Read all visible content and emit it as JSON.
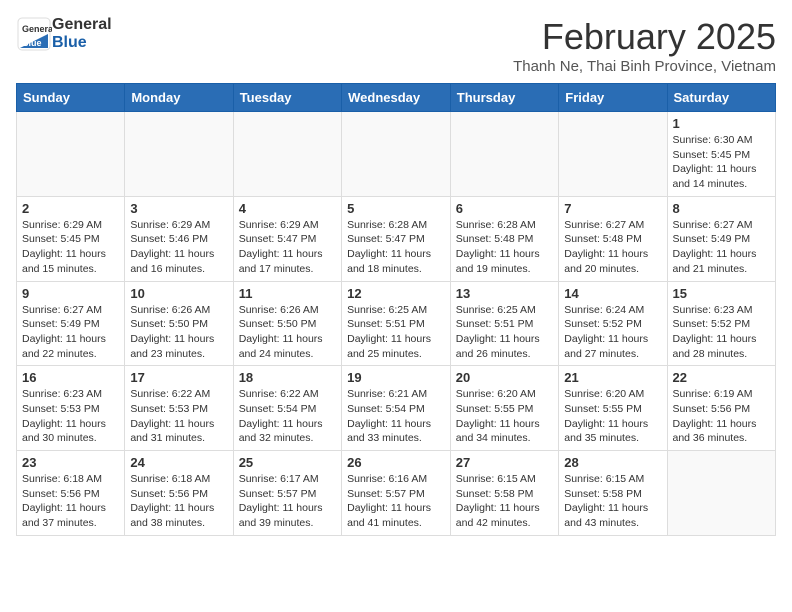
{
  "header": {
    "logo_general": "General",
    "logo_blue": "Blue",
    "month_title": "February 2025",
    "location": "Thanh Ne, Thai Binh Province, Vietnam"
  },
  "weekdays": [
    "Sunday",
    "Monday",
    "Tuesday",
    "Wednesday",
    "Thursday",
    "Friday",
    "Saturday"
  ],
  "weeks": [
    [
      {
        "day": "",
        "info": ""
      },
      {
        "day": "",
        "info": ""
      },
      {
        "day": "",
        "info": ""
      },
      {
        "day": "",
        "info": ""
      },
      {
        "day": "",
        "info": ""
      },
      {
        "day": "",
        "info": ""
      },
      {
        "day": "1",
        "info": "Sunrise: 6:30 AM\nSunset: 5:45 PM\nDaylight: 11 hours\nand 14 minutes."
      }
    ],
    [
      {
        "day": "2",
        "info": "Sunrise: 6:29 AM\nSunset: 5:45 PM\nDaylight: 11 hours\nand 15 minutes."
      },
      {
        "day": "3",
        "info": "Sunrise: 6:29 AM\nSunset: 5:46 PM\nDaylight: 11 hours\nand 16 minutes."
      },
      {
        "day": "4",
        "info": "Sunrise: 6:29 AM\nSunset: 5:47 PM\nDaylight: 11 hours\nand 17 minutes."
      },
      {
        "day": "5",
        "info": "Sunrise: 6:28 AM\nSunset: 5:47 PM\nDaylight: 11 hours\nand 18 minutes."
      },
      {
        "day": "6",
        "info": "Sunrise: 6:28 AM\nSunset: 5:48 PM\nDaylight: 11 hours\nand 19 minutes."
      },
      {
        "day": "7",
        "info": "Sunrise: 6:27 AM\nSunset: 5:48 PM\nDaylight: 11 hours\nand 20 minutes."
      },
      {
        "day": "8",
        "info": "Sunrise: 6:27 AM\nSunset: 5:49 PM\nDaylight: 11 hours\nand 21 minutes."
      }
    ],
    [
      {
        "day": "9",
        "info": "Sunrise: 6:27 AM\nSunset: 5:49 PM\nDaylight: 11 hours\nand 22 minutes."
      },
      {
        "day": "10",
        "info": "Sunrise: 6:26 AM\nSunset: 5:50 PM\nDaylight: 11 hours\nand 23 minutes."
      },
      {
        "day": "11",
        "info": "Sunrise: 6:26 AM\nSunset: 5:50 PM\nDaylight: 11 hours\nand 24 minutes."
      },
      {
        "day": "12",
        "info": "Sunrise: 6:25 AM\nSunset: 5:51 PM\nDaylight: 11 hours\nand 25 minutes."
      },
      {
        "day": "13",
        "info": "Sunrise: 6:25 AM\nSunset: 5:51 PM\nDaylight: 11 hours\nand 26 minutes."
      },
      {
        "day": "14",
        "info": "Sunrise: 6:24 AM\nSunset: 5:52 PM\nDaylight: 11 hours\nand 27 minutes."
      },
      {
        "day": "15",
        "info": "Sunrise: 6:23 AM\nSunset: 5:52 PM\nDaylight: 11 hours\nand 28 minutes."
      }
    ],
    [
      {
        "day": "16",
        "info": "Sunrise: 6:23 AM\nSunset: 5:53 PM\nDaylight: 11 hours\nand 30 minutes."
      },
      {
        "day": "17",
        "info": "Sunrise: 6:22 AM\nSunset: 5:53 PM\nDaylight: 11 hours\nand 31 minutes."
      },
      {
        "day": "18",
        "info": "Sunrise: 6:22 AM\nSunset: 5:54 PM\nDaylight: 11 hours\nand 32 minutes."
      },
      {
        "day": "19",
        "info": "Sunrise: 6:21 AM\nSunset: 5:54 PM\nDaylight: 11 hours\nand 33 minutes."
      },
      {
        "day": "20",
        "info": "Sunrise: 6:20 AM\nSunset: 5:55 PM\nDaylight: 11 hours\nand 34 minutes."
      },
      {
        "day": "21",
        "info": "Sunrise: 6:20 AM\nSunset: 5:55 PM\nDaylight: 11 hours\nand 35 minutes."
      },
      {
        "day": "22",
        "info": "Sunrise: 6:19 AM\nSunset: 5:56 PM\nDaylight: 11 hours\nand 36 minutes."
      }
    ],
    [
      {
        "day": "23",
        "info": "Sunrise: 6:18 AM\nSunset: 5:56 PM\nDaylight: 11 hours\nand 37 minutes."
      },
      {
        "day": "24",
        "info": "Sunrise: 6:18 AM\nSunset: 5:56 PM\nDaylight: 11 hours\nand 38 minutes."
      },
      {
        "day": "25",
        "info": "Sunrise: 6:17 AM\nSunset: 5:57 PM\nDaylight: 11 hours\nand 39 minutes."
      },
      {
        "day": "26",
        "info": "Sunrise: 6:16 AM\nSunset: 5:57 PM\nDaylight: 11 hours\nand 41 minutes."
      },
      {
        "day": "27",
        "info": "Sunrise: 6:15 AM\nSunset: 5:58 PM\nDaylight: 11 hours\nand 42 minutes."
      },
      {
        "day": "28",
        "info": "Sunrise: 6:15 AM\nSunset: 5:58 PM\nDaylight: 11 hours\nand 43 minutes."
      },
      {
        "day": "",
        "info": ""
      }
    ]
  ]
}
